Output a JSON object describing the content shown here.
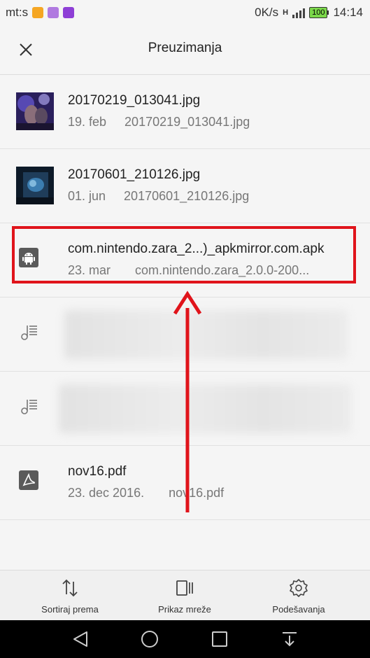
{
  "status": {
    "carrier": "mt:s",
    "speed": "0K/s",
    "network": "H",
    "battery": "100",
    "time": "14:14",
    "notif_colors": [
      "#f5a623",
      "#9b59d0",
      "#8e3fd6"
    ]
  },
  "header": {
    "title": "Preuzimanja"
  },
  "files": [
    {
      "name": "20170219_013041.jpg",
      "date": "19. feb",
      "detail": "20170219_013041.jpg",
      "icon": "image-thumbnail"
    },
    {
      "name": "20170601_210126.jpg",
      "date": "01. jun",
      "detail": "20170601_210126.jpg",
      "icon": "image-thumbnail"
    },
    {
      "name": "com.nintendo.zara_2...)_apkmirror.com.apk",
      "date": "23. mar",
      "detail": "com.nintendo.zara_2.0.0-200...",
      "icon": "android-icon"
    },
    {
      "name": "",
      "date": "",
      "detail": "",
      "icon": "music-icon",
      "blurred": true
    },
    {
      "name": "",
      "date": "",
      "detail": "",
      "icon": "music-icon",
      "blurred": true
    },
    {
      "name": "nov16.pdf",
      "date": "23. dec 2016.",
      "detail": "nov16.pdf",
      "icon": "pdf-icon"
    }
  ],
  "bottom": {
    "sort_label": "Sortiraj prema",
    "grid_label": "Prikaz mreže",
    "settings_label": "Podešavanja"
  },
  "colors": {
    "highlight": "#e0141b",
    "accent": "#7bd84a"
  }
}
